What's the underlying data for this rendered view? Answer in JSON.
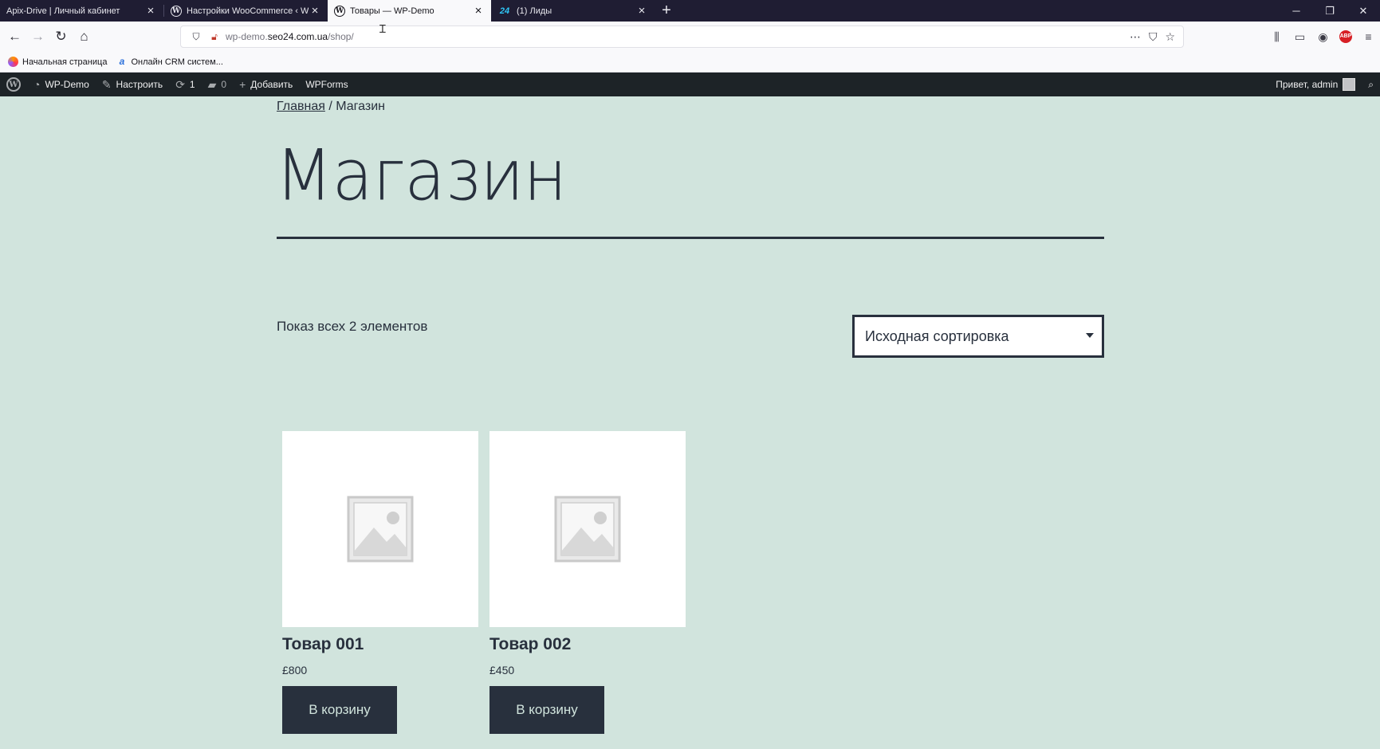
{
  "browser": {
    "tabs": [
      {
        "title": "Apix-Drive | Личный кабинет",
        "active": false
      },
      {
        "title": "Настройки WooCommerce ‹ W",
        "active": false
      },
      {
        "title": "Товары — WP-Demo",
        "active": true
      },
      {
        "title": "(1) Лиды",
        "active": false
      }
    ],
    "new_tab": "+",
    "window_controls": {
      "minimize": "─",
      "restore": "❐",
      "close": "✕"
    },
    "url": {
      "prefix": "wp-demo.",
      "domain": "seo24.com.ua",
      "path": "/shop/"
    },
    "bookmarks": [
      {
        "label": "Начальная страница",
        "icon": "firefox-icon"
      },
      {
        "label": "Онлайн CRM систем...",
        "icon": "apix-icon"
      }
    ]
  },
  "admin_bar": {
    "site_name": "WP-Demo",
    "customize": "Настроить",
    "updates_count": "1",
    "comments_count": "0",
    "add_new": "Добавить",
    "wpforms": "WPForms",
    "greeting": "Привет, admin"
  },
  "page": {
    "breadcrumb_home": "Главная",
    "breadcrumb_sep": " / ",
    "breadcrumb_current": "Магазин",
    "title": "Магазин",
    "result_count": "Показ всех 2 элементов",
    "orderby_selected": "Исходная сортировка"
  },
  "products": [
    {
      "name": "Товар 001",
      "price": "£800",
      "button": "В корзину"
    },
    {
      "name": "Товар 002",
      "price": "£450",
      "button": "В корзину"
    }
  ],
  "colors": {
    "background": "#d1e4dd",
    "text": "#28303d",
    "admin_bar": "#1d2327"
  }
}
